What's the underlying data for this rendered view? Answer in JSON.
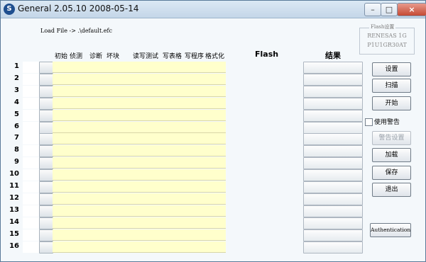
{
  "window": {
    "title": "General 2.05.10 2008-05-14",
    "icon": "app-logo-icon",
    "controls": [
      "minimize",
      "maximize",
      "close"
    ]
  },
  "load_file_label": "Load File -> .\\default.efc",
  "flash_panel": {
    "legend": "Flash设置",
    "line1": "RENESAS 1G",
    "line2": "P1U1GR30AT"
  },
  "headers": {
    "init": "初始",
    "detect": "侦测",
    "diagnose": "诊断",
    "badblock": "坏块",
    "read_test": "读写测试",
    "write_table": "写表格",
    "write_program": "写程序",
    "format": "格式化",
    "flash": "Flash",
    "result": "结果"
  },
  "rows": [
    "1",
    "2",
    "3",
    "4",
    "5",
    "6",
    "7",
    "8",
    "9",
    "10",
    "11",
    "12",
    "13",
    "14",
    "15",
    "16"
  ],
  "side_buttons": {
    "settings": "设置",
    "scan": "扫描",
    "start": "开始",
    "use_warning": "使用警告",
    "warning_settings": "警告设置",
    "load": "加载",
    "save": "保存",
    "exit": "退出",
    "authentication": "Authentication"
  },
  "colors": {
    "row_field": "#ffffcc",
    "title_bar": "#c4d6e8",
    "close_button": "#c54a34"
  }
}
